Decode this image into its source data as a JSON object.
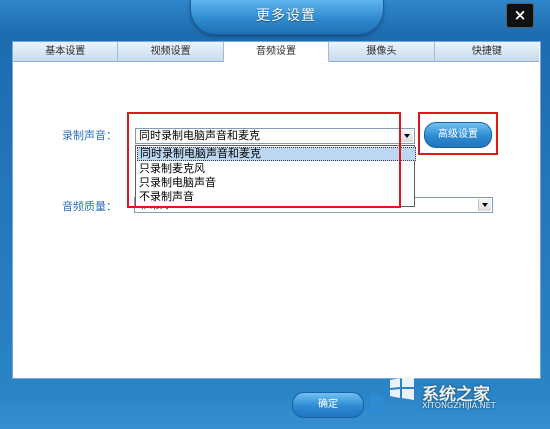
{
  "window": {
    "title": "更多设置",
    "close_glyph": "×"
  },
  "tabs": [
    {
      "label": "基本设置",
      "active": false
    },
    {
      "label": "视频设置",
      "active": false
    },
    {
      "label": "音频设置",
      "active": true
    },
    {
      "label": "摄像头",
      "active": false
    },
    {
      "label": "快捷键",
      "active": false
    }
  ],
  "record_sound": {
    "label": "录制声音：",
    "value": "同时录制电脑声音和麦克",
    "options": [
      "同时录制电脑声音和麦克",
      "只录制麦克风",
      "只录制电脑声音",
      "不录制声音"
    ]
  },
  "audio_quality": {
    "label": "音频质量：",
    "value": "非常好"
  },
  "advanced_button": {
    "label": "高级设置"
  },
  "ok_button": {
    "label": "确定"
  },
  "watermark": {
    "text": "系统之家",
    "url": "XITONGZHIJIA.NET"
  }
}
